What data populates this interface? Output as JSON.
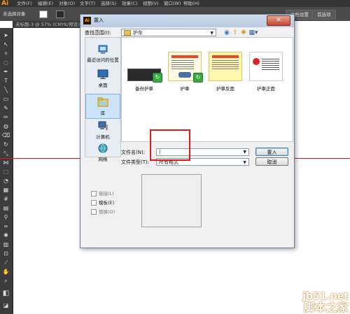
{
  "menubar": {
    "logo": "Ai",
    "items": [
      "文件(F)",
      "编辑(E)",
      "对象(O)",
      "文字(T)",
      "选择(S)",
      "效果(C)",
      "视图(V)",
      "窗口(W)",
      "帮助(H)"
    ]
  },
  "controlbar": {
    "selection_status": "未选择对象",
    "doc_setup_label": "文档设置",
    "preferences_label": "首选项"
  },
  "document_tab": {
    "label": "未标题-3 @ 57% (CMYK/预览)"
  },
  "dialog": {
    "title": "置入",
    "close_glyph": "✕",
    "lookin_label": "查找范围(I):",
    "lookin_value": "护车",
    "places": [
      {
        "label": "最近访问的位置",
        "icon": "recent-places-icon"
      },
      {
        "label": "桌面",
        "icon": "desktop-icon"
      },
      {
        "label": "库",
        "icon": "libraries-icon"
      },
      {
        "label": "计算机",
        "icon": "computer-icon"
      },
      {
        "label": "网络",
        "icon": "network-icon"
      }
    ],
    "files": [
      {
        "name": "备份护車",
        "thumb": "dark"
      },
      {
        "name": "护車",
        "thumb": "card"
      },
      {
        "name": "护車反面",
        "thumb": "card"
      },
      {
        "name": "护車正面",
        "thumb": "white"
      }
    ],
    "filename_label": "文件名(N):",
    "filename_value": "|",
    "filetype_label": "文件类型(T):",
    "filetype_value": "所有格式",
    "place_button": "置入",
    "cancel_button": "取消",
    "options": [
      {
        "label": "链接(L)",
        "checked": false,
        "enabled": false
      },
      {
        "label": "模板(E)",
        "checked": false,
        "enabled": true
      },
      {
        "label": "替换(O)",
        "checked": false,
        "enabled": false
      }
    ]
  },
  "watermark": {
    "line1": "jb51.net",
    "line2": "脚本之家"
  },
  "colors": {
    "guide": "#e01818",
    "highlight_box": "#e01818",
    "ai_orange": "#ff9a00"
  }
}
